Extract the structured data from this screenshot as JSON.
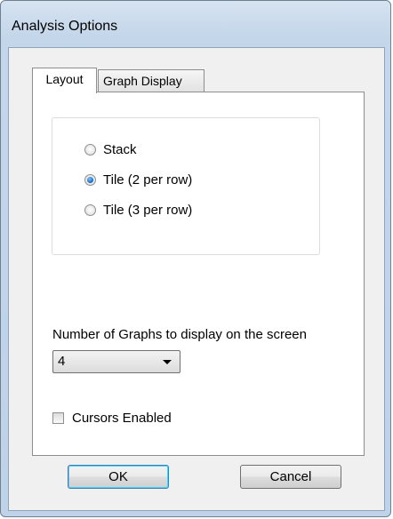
{
  "window": {
    "title": "Analysis Options"
  },
  "tabs": [
    {
      "label": "Layout",
      "selected": true
    },
    {
      "label": "Graph Display",
      "selected": false
    }
  ],
  "layout_options": [
    {
      "label": "Stack",
      "checked": false
    },
    {
      "label": "Tile (2 per row)",
      "checked": true
    },
    {
      "label": "Tile (3 per row)",
      "checked": false
    }
  ],
  "graphs": {
    "label": "Number of Graphs to display on the screen",
    "selected": "4"
  },
  "cursors": {
    "label": "Cursors Enabled",
    "checked": false
  },
  "buttons": {
    "ok": "OK",
    "cancel": "Cancel"
  }
}
